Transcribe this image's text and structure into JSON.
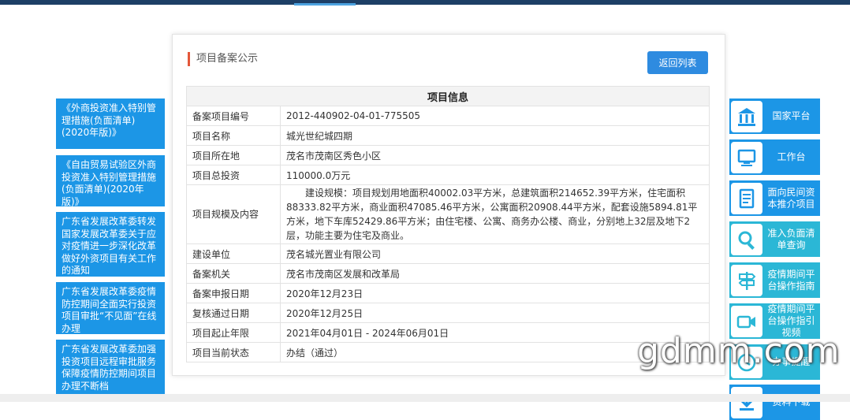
{
  "news": [
    "《外商投资准入特别管理措施(负面清单)(2020年版)》",
    "《自由贸易试验区外商投资准入特别管理措施(负面清单)(2020年版)》",
    "广东省发展改革委转发国家发展改革委关于应对疫情进一步深化改革做好外资项目有关工作的通知",
    "广东省发展改革委疫情防控期间全面实行投资项目审批“不见面”在线办理",
    "广东省发展改革委加强投资项目远程审批服务保障疫情防控期间项目办理不断档"
  ],
  "panel": {
    "title": "项目备案公示",
    "back_label": "返回列表",
    "table_header": "项目信息"
  },
  "rows": {
    "code": {
      "label": "备案项目编号",
      "value": "2012-440902-04-01-775505"
    },
    "name": {
      "label": "项目名称",
      "value": "城光世纪城四期"
    },
    "location": {
      "label": "项目所在地",
      "value": "茂名市茂南区秀色小区"
    },
    "investment": {
      "label": "项目总投资",
      "value": "110000.0万元"
    },
    "scale": {
      "label": "项目规模及内容",
      "value": "建设规模：项目规划用地面积40002.03平方米，总建筑面积214652.39平方米，住宅面积88333.82平方米，商业面积47085.46平方米，公寓面积20908.44平方米，配套设施5894.81平方米，地下车库52429.86平方米；由住宅楼、公寓、商务办公楼、商业，分别地上32层及地下2层，功能主要为住宅及商业。"
    },
    "builder": {
      "label": "建设单位",
      "value": "茂名城光置业有限公司"
    },
    "authority": {
      "label": "备案机关",
      "value": "茂名市茂南区发展和改革局"
    },
    "apply_date": {
      "label": "备案申报日期",
      "value": "2020年12月23日"
    },
    "review_date": {
      "label": "复核通过日期",
      "value": "2020年12月25日"
    },
    "period": {
      "label": "项目起止年限",
      "value": "2021年04月01日 - 2024年06月01日"
    },
    "status": {
      "label": "项目当前状态",
      "value": "办结（通过）"
    }
  },
  "sidebar": [
    {
      "label": "国家平台",
      "icon": "bank-icon"
    },
    {
      "label": "工作台",
      "icon": "monitor-icon"
    },
    {
      "label": "面向民间资本推介项目",
      "icon": "document-icon"
    },
    {
      "label": "准入负面清单查询",
      "icon": "search-icon"
    },
    {
      "label": "疫情期间平台操作指南",
      "icon": "signpost-icon"
    },
    {
      "label": "疫情期间平台操作指引视频",
      "icon": "video-camera-icon"
    },
    {
      "label": "办事提醒",
      "icon": "clock-icon"
    },
    {
      "label": "资料下载",
      "icon": "download-icon"
    }
  ],
  "colors": {
    "accent_blue": "#1c96e6",
    "teal": "#2bb7d6",
    "title_bar": "#e4573a",
    "button": "#2e8be0"
  },
  "watermark": "gdmm.com"
}
